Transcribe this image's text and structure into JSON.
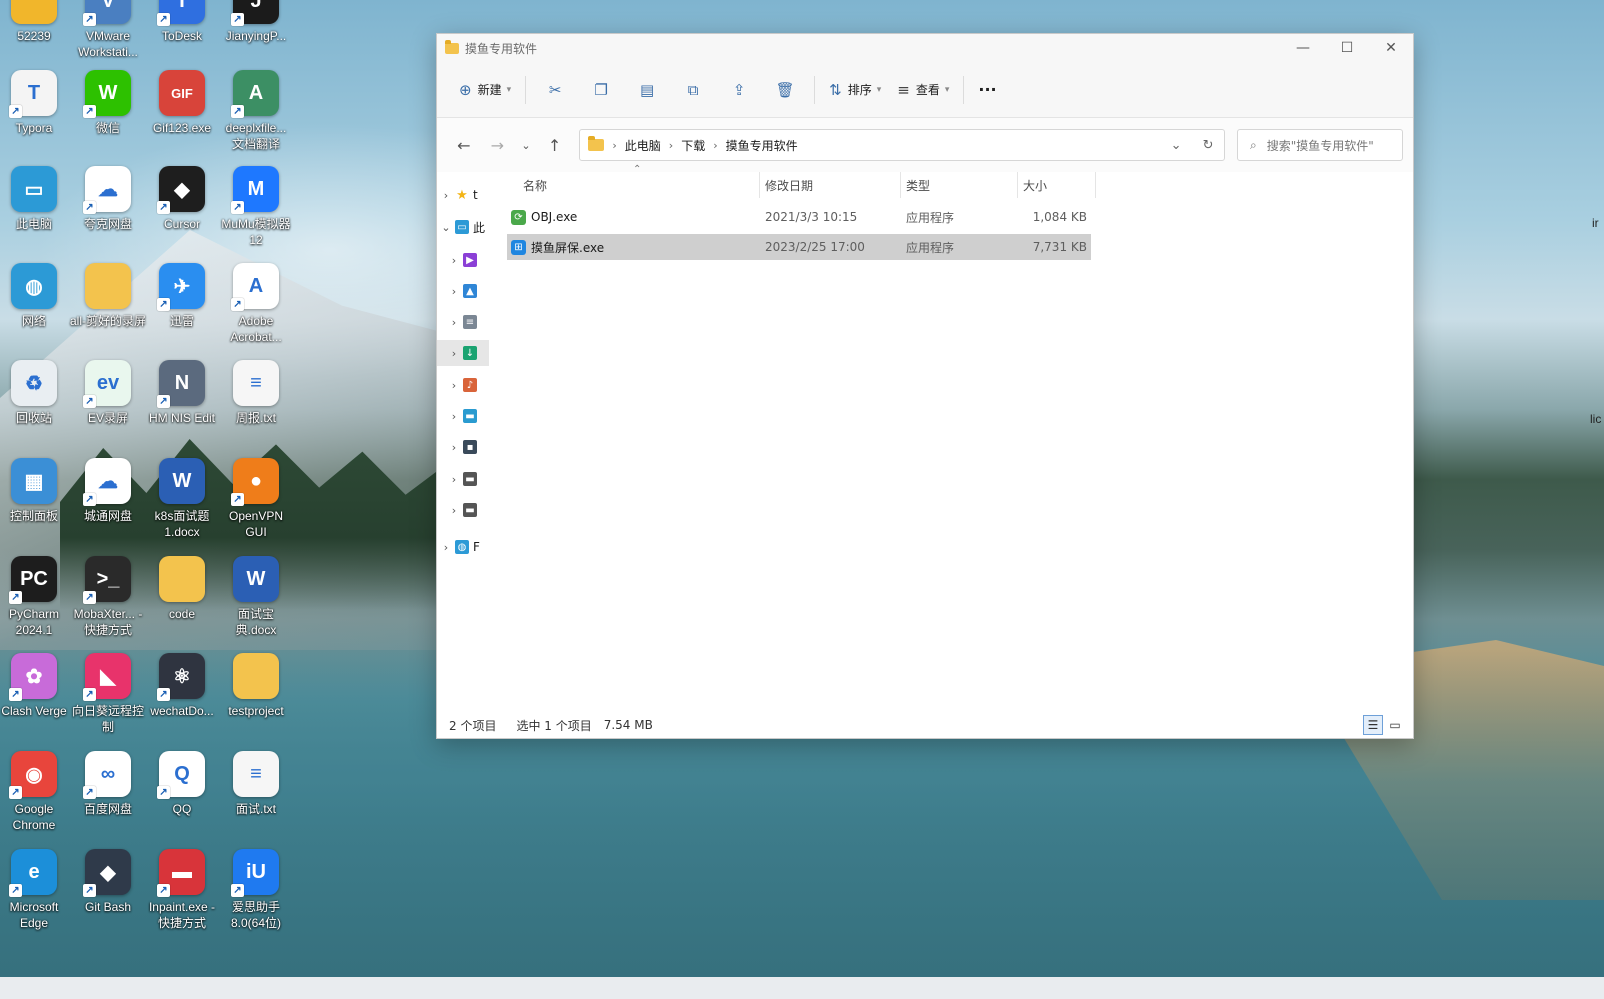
{
  "desktop": {
    "icons": [
      {
        "label": "52239",
        "color": "#f1b62b",
        "glyph": "",
        "shortcut": false
      },
      {
        "label": "VMware Workstati...",
        "color": "#4a7fc1",
        "glyph": "V",
        "shortcut": true
      },
      {
        "label": "ToDesk",
        "color": "#2f6fe0",
        "glyph": "T",
        "shortcut": true
      },
      {
        "label": "JianyingP...",
        "color": "#1b1b1b",
        "glyph": "J",
        "shortcut": true
      },
      {
        "label": "Typora",
        "color": "#f4f4f4",
        "glyph": "T",
        "shortcut": true
      },
      {
        "label": "微信",
        "color": "#2dc100",
        "glyph": "W",
        "shortcut": true
      },
      {
        "label": "Gif123.exe",
        "color": "#d8443a",
        "glyph": "GIF",
        "shortcut": false
      },
      {
        "label": "deeplxfile... 文档翻译",
        "color": "#3c8f64",
        "glyph": "A",
        "shortcut": true
      },
      {
        "label": "此电脑",
        "color": "#2c9ad6",
        "glyph": "▭",
        "shortcut": false
      },
      {
        "label": "夸克网盘",
        "color": "#ffffff",
        "glyph": "☁",
        "shortcut": true
      },
      {
        "label": "Cursor",
        "color": "#1e1e1e",
        "glyph": "◆",
        "shortcut": true
      },
      {
        "label": "MuMu模拟器12",
        "color": "#1e78ff",
        "glyph": "M",
        "shortcut": true
      },
      {
        "label": "网络",
        "color": "#2c9ad6",
        "glyph": "◍",
        "shortcut": false
      },
      {
        "label": "all-剪好的录屏",
        "color": "#f3c34d",
        "glyph": "",
        "shortcut": false
      },
      {
        "label": "迅雷",
        "color": "#2a8ef0",
        "glyph": "✈",
        "shortcut": true
      },
      {
        "label": "Adobe Acrobat...",
        "color": "#ffffff",
        "glyph": "A",
        "shortcut": true
      },
      {
        "label": "回收站",
        "color": "#e9eef2",
        "glyph": "♻",
        "shortcut": false
      },
      {
        "label": "EV录屏",
        "color": "#e9f7ee",
        "glyph": "ev",
        "shortcut": true
      },
      {
        "label": "HM NIS Edit",
        "color": "#5b6a7e",
        "glyph": "N",
        "shortcut": true
      },
      {
        "label": "周报.txt",
        "color": "#f6f6f6",
        "glyph": "≡",
        "shortcut": false
      },
      {
        "label": "控制面板",
        "color": "#3b8fd6",
        "glyph": "▦",
        "shortcut": false
      },
      {
        "label": "城通网盘",
        "color": "#ffffff",
        "glyph": "☁",
        "shortcut": true
      },
      {
        "label": "k8s面试题1.docx",
        "color": "#2b5fb4",
        "glyph": "W",
        "shortcut": false
      },
      {
        "label": "OpenVPN GUI",
        "color": "#ef7d1a",
        "glyph": "●",
        "shortcut": true
      },
      {
        "label": "PyCharm 2024.1",
        "color": "#1d1d1d",
        "glyph": "PC",
        "shortcut": true
      },
      {
        "label": "MobaXter... - 快捷方式",
        "color": "#2a2a2a",
        "glyph": ">_",
        "shortcut": true
      },
      {
        "label": "code",
        "color": "#f3c34d",
        "glyph": "",
        "shortcut": false
      },
      {
        "label": "面试宝典.docx",
        "color": "#2b5fb4",
        "glyph": "W",
        "shortcut": false
      },
      {
        "label": "Clash Verge",
        "color": "#c86bd9",
        "glyph": "✿",
        "shortcut": true
      },
      {
        "label": "向日葵远程控制",
        "color": "#e8336b",
        "glyph": "◣",
        "shortcut": true
      },
      {
        "label": "wechatDo...",
        "color": "#2f3440",
        "glyph": "⚛",
        "shortcut": true
      },
      {
        "label": "testproject",
        "color": "#f3c34d",
        "glyph": "",
        "shortcut": false
      },
      {
        "label": "Google Chrome",
        "color": "#e8453c",
        "glyph": "◉",
        "shortcut": true
      },
      {
        "label": "百度网盘",
        "color": "#ffffff",
        "glyph": "∞",
        "shortcut": true
      },
      {
        "label": "QQ",
        "color": "#ffffff",
        "glyph": "Q",
        "shortcut": true
      },
      {
        "label": "面试.txt",
        "color": "#f6f6f6",
        "glyph": "≡",
        "shortcut": false
      },
      {
        "label": "Microsoft Edge",
        "color": "#1c8fd9",
        "glyph": "e",
        "shortcut": true
      },
      {
        "label": "Git Bash",
        "color": "#2f3a4a",
        "glyph": "◆",
        "shortcut": true
      },
      {
        "label": "Inpaint.exe - 快捷方式",
        "color": "#d8343a",
        "glyph": "▬",
        "shortcut": true
      },
      {
        "label": "爱思助手8.0(64位)",
        "color": "#1f7af0",
        "glyph": "iU",
        "shortcut": true
      }
    ],
    "edge_labels": [
      "ir",
      "lic"
    ]
  },
  "window": {
    "title": "摸鱼专用软件",
    "controls": {
      "minimize": "—",
      "maximize": "☐",
      "close": "✕"
    },
    "toolbar": {
      "new_label": "新建",
      "sort_label": "排序",
      "view_label": "查看",
      "more_label": "···"
    },
    "address": {
      "crumbs": [
        "此电脑",
        "下载",
        "摸鱼专用软件"
      ]
    },
    "search": {
      "placeholder": "搜索\"摸鱼专用软件\""
    },
    "nav_tree": [
      {
        "chev": "›",
        "icon": "★",
        "color": "#f3b416",
        "label": "t"
      },
      {
        "chev": "⌄",
        "icon": "▭",
        "color": "#2c9ad6",
        "label": "此"
      },
      {
        "chev": "›",
        "icon": "▶",
        "color": "#8b3fd6",
        "label": ""
      },
      {
        "chev": "›",
        "icon": "▲",
        "color": "#2f86d6",
        "label": ""
      },
      {
        "chev": "›",
        "icon": "≡",
        "color": "#7b8794",
        "label": ""
      },
      {
        "chev": "›",
        "icon": "↓",
        "color": "#1aa371",
        "label": ""
      },
      {
        "chev": "›",
        "icon": "♪",
        "color": "#d9643a",
        "label": ""
      },
      {
        "chev": "›",
        "icon": "▬",
        "color": "#2a9bd0",
        "label": ""
      },
      {
        "chev": "›",
        "icon": "▪",
        "color": "#3a4a5a",
        "label": ""
      },
      {
        "chev": "›",
        "icon": "▬",
        "color": "#555555",
        "label": ""
      },
      {
        "chev": "›",
        "icon": "▬",
        "color": "#555555",
        "label": ""
      },
      {
        "chev": "›",
        "icon": "◍",
        "color": "#2c9ad6",
        "label": "F"
      }
    ],
    "columns": {
      "name": "名称",
      "modified": "修改日期",
      "type": "类型",
      "size": "大小"
    },
    "files": [
      {
        "name": "OBJ.exe",
        "modified": "2021/3/3 10:15",
        "type": "应用程序",
        "size": "1,084 KB",
        "icon_color": "#4aa84a",
        "selected": false
      },
      {
        "name": "摸鱼屏保.exe",
        "modified": "2023/2/25 17:00",
        "type": "应用程序",
        "size": "7,731 KB",
        "icon_color": "#1f86e0",
        "selected": true
      }
    ],
    "status": {
      "count": "2 个项目",
      "selection": "选中 1 个项目",
      "selection_size": "7.54 MB"
    }
  }
}
